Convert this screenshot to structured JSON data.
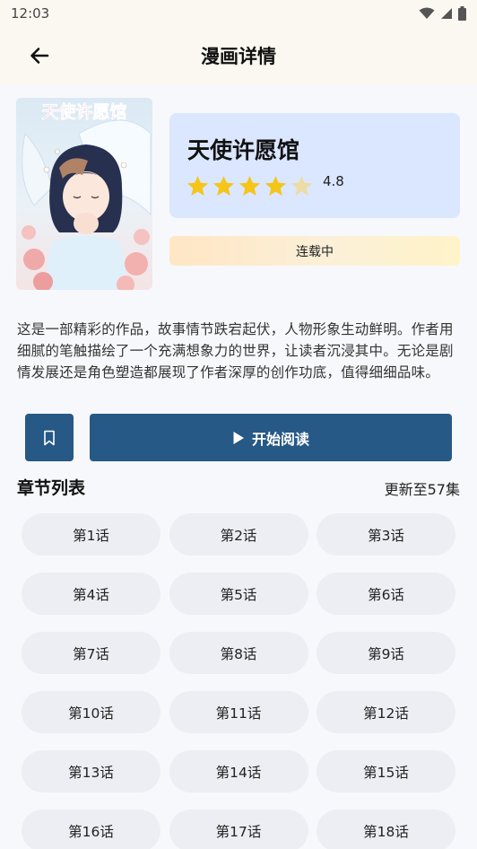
{
  "status_bar": {
    "time": "12:03"
  },
  "app_bar": {
    "title": "漫画详情"
  },
  "manga": {
    "cover_title_art": "天使许愿馆",
    "title": "天使许愿馆",
    "rating": 4.8,
    "rating_label": "4.8",
    "status": "连载中",
    "description": "这是一部精彩的作品，故事情节跌宕起伏，人物形象生动鲜明。作者用细腻的笔触描绘了一个充满想象力的世界，让读者沉浸其中。无论是剧情发展还是角色塑造都展现了作者深厚的创作功底，值得细细品味。"
  },
  "actions": {
    "read_label": "开始阅读"
  },
  "chapters": {
    "section_title": "章节列表",
    "update_label": "更新至57集",
    "items": [
      "第1话",
      "第2话",
      "第3话",
      "第4话",
      "第5话",
      "第6话",
      "第7话",
      "第8话",
      "第9话",
      "第10话",
      "第11话",
      "第12话",
      "第13话",
      "第14话",
      "第15话",
      "第16话",
      "第17话",
      "第18话"
    ]
  },
  "colors": {
    "primary": "#265985",
    "star": "#f5c518",
    "info_card": "#dbe6ff"
  }
}
